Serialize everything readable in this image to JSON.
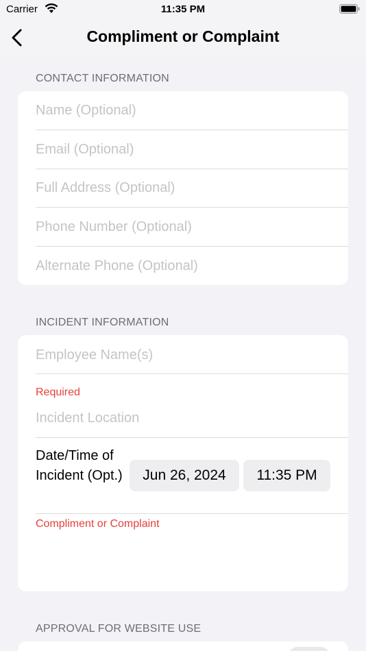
{
  "status_bar": {
    "carrier": "Carrier",
    "time": "11:35 PM"
  },
  "nav": {
    "title": "Compliment or Complaint",
    "back_icon": "chevron-left-icon"
  },
  "contact": {
    "header": "CONTACT INFORMATION",
    "fields": [
      {
        "placeholder": "Name (Optional)"
      },
      {
        "placeholder": "Email (Optional)"
      },
      {
        "placeholder": "Full Address (Optional)"
      },
      {
        "placeholder": "Phone Number (Optional)"
      },
      {
        "placeholder": "Alternate Phone (Optional)"
      }
    ]
  },
  "incident": {
    "header": "INCIDENT INFORMATION",
    "employee_placeholder": "Employee Name(s)",
    "required_label": "Required",
    "location_placeholder": "Incident Location",
    "datetime_label": "Date/Time of Incident (Opt.)",
    "date_value": "Jun 26, 2024",
    "time_value": "11:35 PM",
    "compliment_label": "Compliment or Complaint"
  },
  "approval": {
    "header": "APPROVAL FOR WEBSITE USE"
  },
  "colors": {
    "background": "#f2f2f7",
    "required": "#e5403a",
    "placeholder": "#c4c4c7"
  }
}
